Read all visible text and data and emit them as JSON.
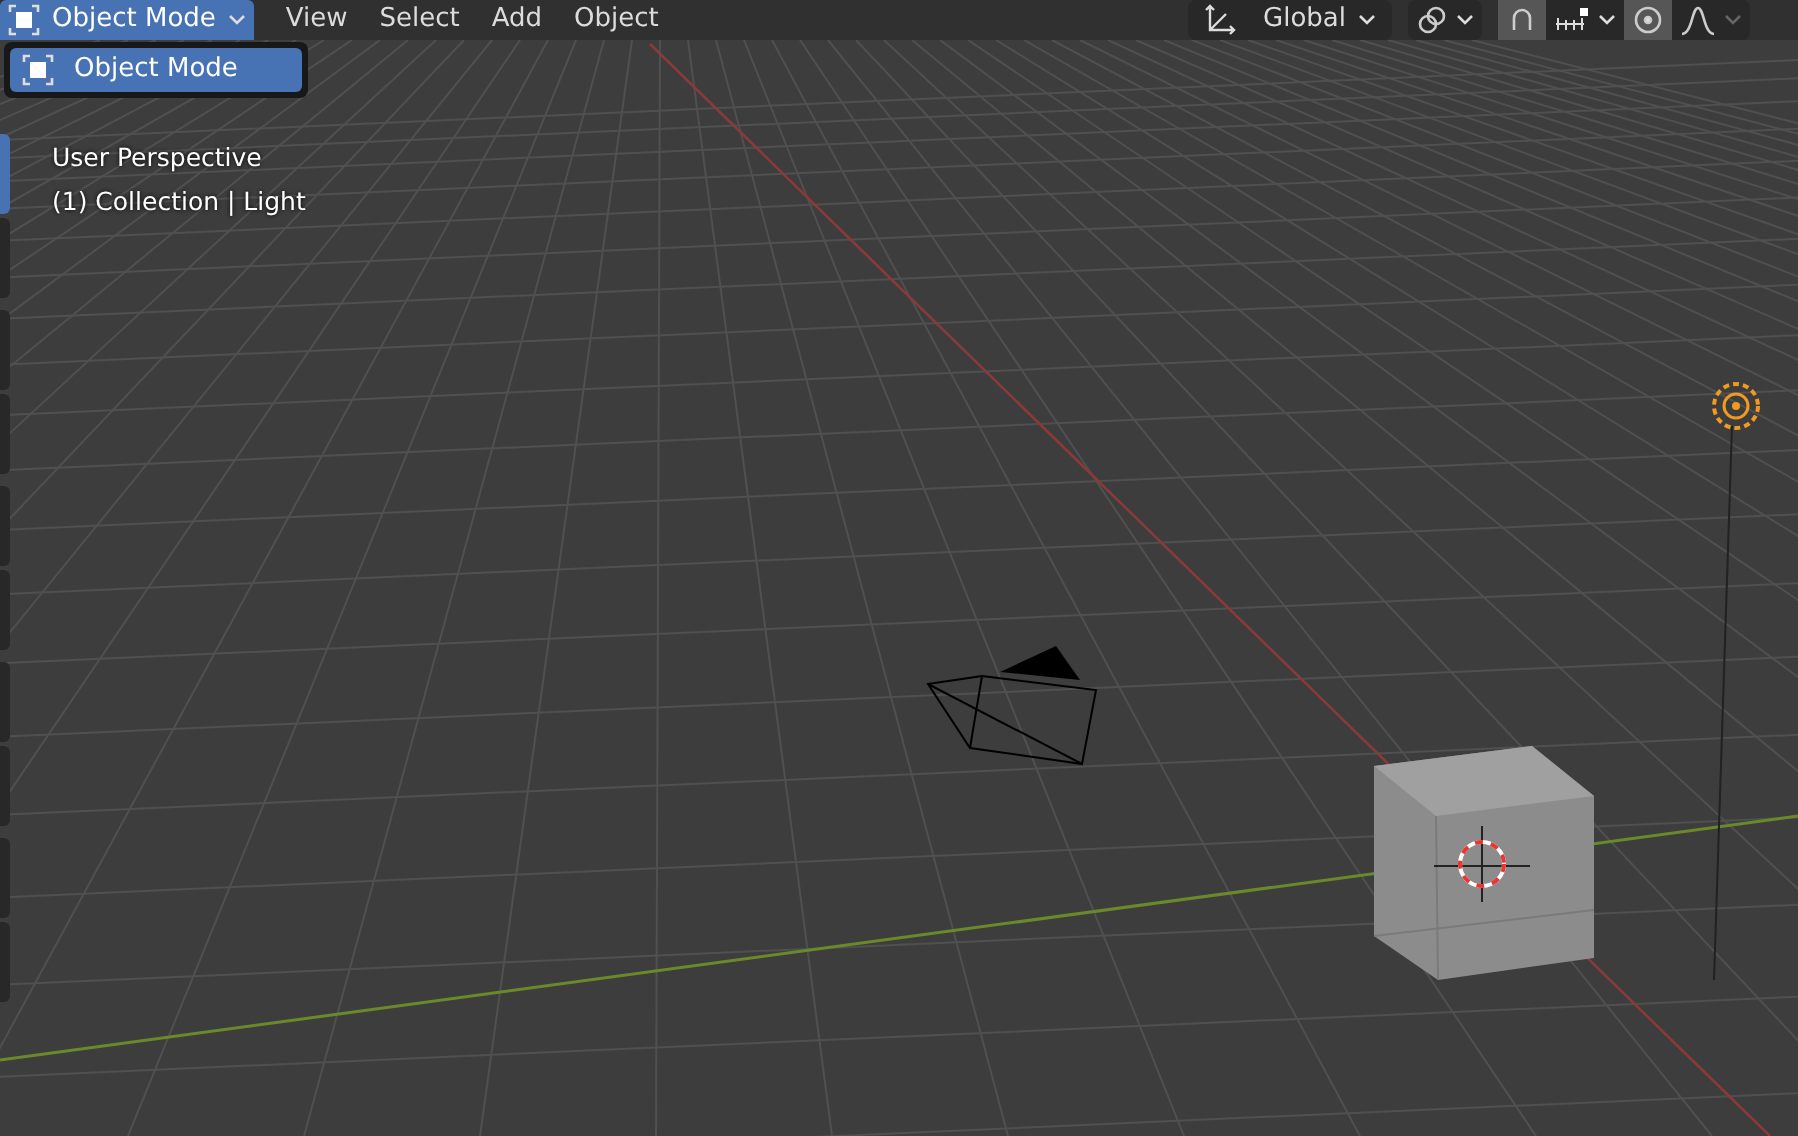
{
  "header": {
    "mode_button": {
      "label": "Object Mode"
    },
    "menus": [
      {
        "label": "View"
      },
      {
        "label": "Select"
      },
      {
        "label": "Add"
      },
      {
        "label": "Object"
      }
    ],
    "orientation": {
      "label": "Global"
    },
    "toggles": [
      {
        "kind": "pivot",
        "on": false
      },
      {
        "kind": "snap",
        "on": true
      },
      {
        "kind": "proportional",
        "on": true
      }
    ]
  },
  "mode_menu": {
    "items": [
      {
        "label": "Object Mode",
        "selected": true
      }
    ]
  },
  "toolbar": [
    {
      "selected": true
    },
    {
      "selected": false
    },
    {
      "selected": false
    },
    {
      "selected": false
    },
    {
      "selected": false
    },
    {
      "selected": false
    },
    {
      "selected": false
    },
    {
      "selected": false
    },
    {
      "selected": false
    },
    {
      "selected": false
    }
  ],
  "viewport": {
    "overlay_lines": [
      "User Perspective",
      "(1) Collection | Light"
    ]
  }
}
